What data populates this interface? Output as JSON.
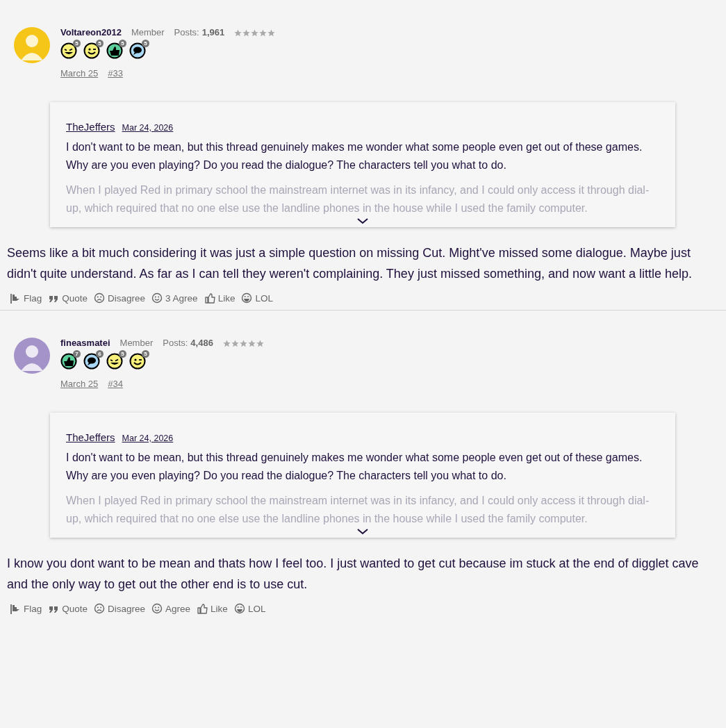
{
  "posts": [
    {
      "author": {
        "name": "Voltareon2012",
        "color": "#f5c518",
        "role": "Member",
        "posts_label": "Posts:",
        "posts_count": "1,961",
        "stars": 0
      },
      "trophies": [
        {
          "kind": "laugh",
          "count": "5"
        },
        {
          "kind": "wink",
          "count": "5"
        },
        {
          "kind": "thumb",
          "count": "5"
        },
        {
          "kind": "chat",
          "count": "5"
        }
      ],
      "date": "March 25",
      "number": "#33",
      "quote": {
        "author": "TheJeffers",
        "date": "Mar 24, 2026",
        "text": "I don't want to be mean, but this thread genuinely makes me wonder what some people even get out of these games. Why are you even playing? Do you read the dialogue? The characters tell you what to do.",
        "more": "When I played Red in primary school the mainstream internet was in its infancy, and I could only access it through dial-up, which required that no one else use the landline phones in the house while I used the family computer."
      },
      "body": "Seems like a bit much considering it was just a simple question on missing Cut. Might've missed some dialogue. Maybe just didn't quite understand. As far as I can tell they weren't complaining. They just missed something, and now want a little help.",
      "actions": [
        {
          "kind": "flag",
          "label": "Flag"
        },
        {
          "kind": "quote",
          "label": "Quote"
        },
        {
          "kind": "sad",
          "label": "Disagree"
        },
        {
          "kind": "smile",
          "label": "3 Agree"
        },
        {
          "kind": "like",
          "label": "Like"
        },
        {
          "kind": "lol",
          "label": "LOL"
        }
      ]
    },
    {
      "author": {
        "name": "fineasmatei",
        "color": "#a393c9",
        "role": "Member",
        "posts_label": "Posts:",
        "posts_count": "4,486",
        "stars": 0
      },
      "trophies": [
        {
          "kind": "thumb",
          "count": "7"
        },
        {
          "kind": "chat",
          "count": "6"
        },
        {
          "kind": "laugh",
          "count": "5"
        },
        {
          "kind": "wink",
          "count": "5"
        }
      ],
      "date": "March 25",
      "number": "#34",
      "quote": {
        "author": "TheJeffers",
        "date": "Mar 24, 2026",
        "text": "I don't want to be mean, but this thread genuinely makes me wonder what some people even get out of these games. Why are you even playing? Do you read the dialogue? The characters tell you what to do.",
        "more": "When I played Red in primary school the mainstream internet was in its infancy, and I could only access it through dial-up, which required that no one else use the landline phones in the house while I used the family computer."
      },
      "body": "I know you dont want to be mean and thats how I feel too. I just wanted to get cut because im stuck at the end of digglet cave and the only way to get out the other end is to use cut.",
      "actions": [
        {
          "kind": "flag",
          "label": "Flag"
        },
        {
          "kind": "quote",
          "label": "Quote"
        },
        {
          "kind": "sad",
          "label": "Disagree"
        },
        {
          "kind": "smile",
          "label": "Agree"
        },
        {
          "kind": "like",
          "label": "Like"
        },
        {
          "kind": "lol",
          "label": "LOL"
        }
      ]
    }
  ]
}
